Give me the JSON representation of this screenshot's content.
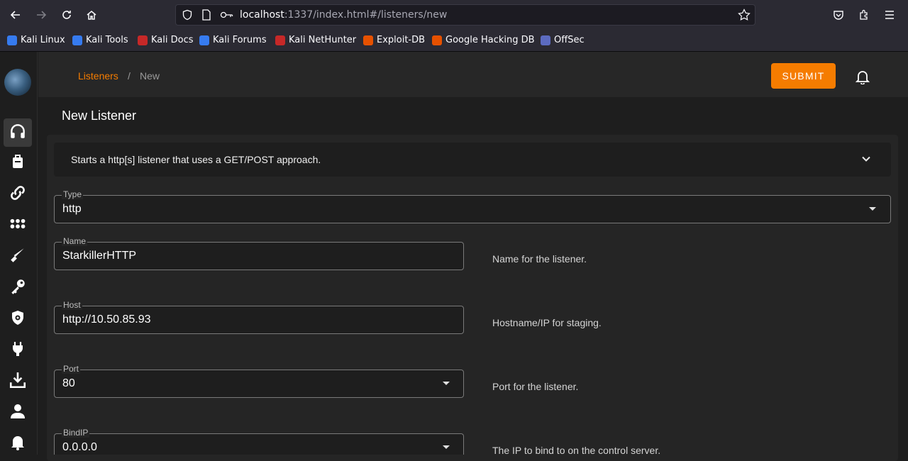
{
  "browser": {
    "url_host": "localhost",
    "url_rest": ":1337/index.html#/listeners/new",
    "bookmarks": [
      {
        "label": "Kali Linux",
        "color": "#367bf0"
      },
      {
        "label": "Kali Tools",
        "color": "#367bf0"
      },
      {
        "label": "Kali Docs",
        "color": "#c62828"
      },
      {
        "label": "Kali Forums",
        "color": "#367bf0"
      },
      {
        "label": "Kali NetHunter",
        "color": "#c62828"
      },
      {
        "label": "Exploit-DB",
        "color": "#e65100"
      },
      {
        "label": "Google Hacking DB",
        "color": "#e65100"
      },
      {
        "label": "OffSec",
        "color": "#5c6bc0"
      }
    ]
  },
  "sidebar": {
    "items": [
      "headphones-icon",
      "briefcase-icon",
      "link-icon",
      "apps-grid-icon",
      "knife-icon",
      "key-icon",
      "shield-gear-icon",
      "plug-icon",
      "download-icon",
      "user-icon",
      "bell-icon"
    ]
  },
  "header": {
    "breadcrumb_link": "Listeners",
    "breadcrumb_sep": "/",
    "breadcrumb_current": "New",
    "submit_label": "SUBMIT"
  },
  "page": {
    "title": "New Listener",
    "description": "Starts a http[s] listener that uses a GET/POST approach."
  },
  "form": {
    "type": {
      "label": "Type",
      "value": "http"
    },
    "name": {
      "label": "Name",
      "value": "StarkillerHTTP",
      "hint": "Name for the listener."
    },
    "host": {
      "label": "Host",
      "value": "http://10.50.85.93",
      "hint": "Hostname/IP for staging."
    },
    "port": {
      "label": "Port",
      "value": "80",
      "hint": "Port for the listener."
    },
    "bindip": {
      "label": "BindIP",
      "value": "0.0.0.0",
      "hint": "The IP to bind to on the control server."
    }
  },
  "colors": {
    "accent": "#f57c00"
  }
}
